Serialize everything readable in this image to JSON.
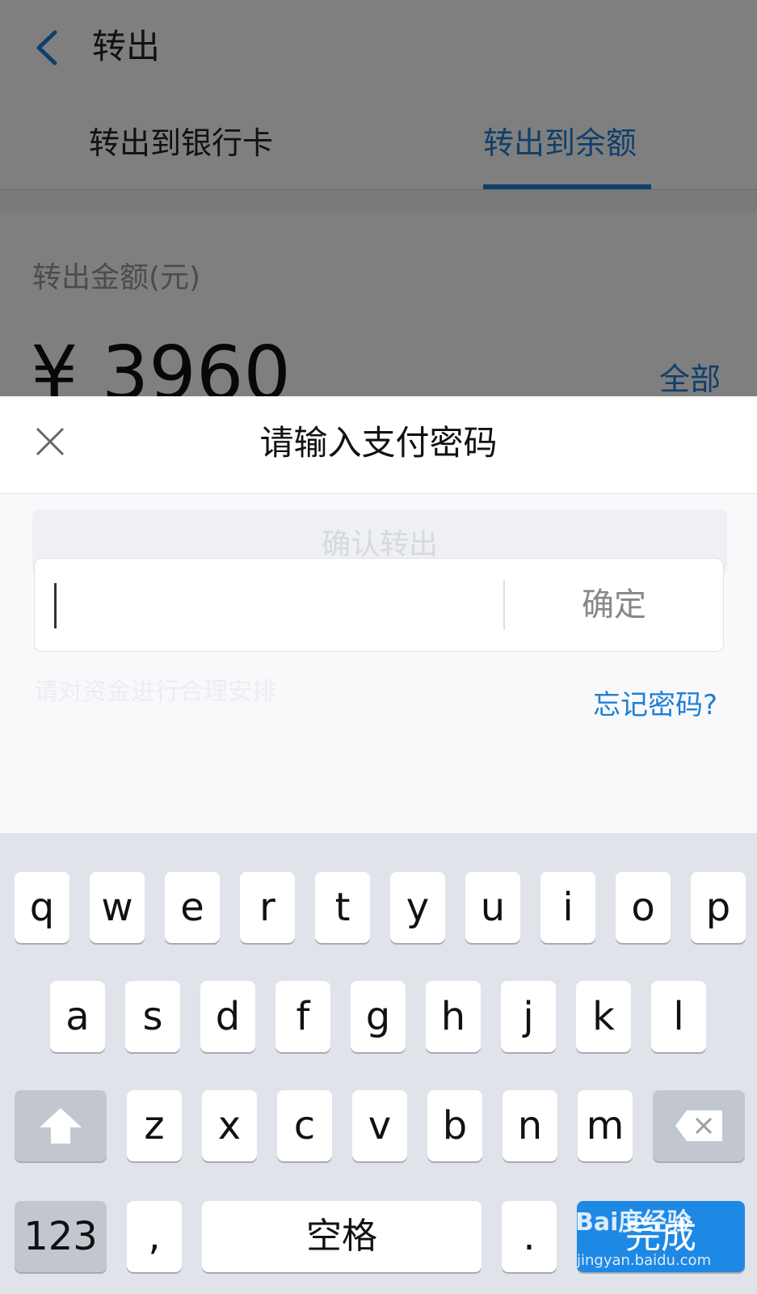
{
  "header": {
    "title": "转出"
  },
  "tabs": [
    {
      "label": "转出到银行卡",
      "active": false
    },
    {
      "label": "转出到余额",
      "active": true
    }
  ],
  "amount": {
    "label": "转出金额(元)",
    "value": "¥ 3960",
    "all_label": "全部"
  },
  "background_button": {
    "label": "确认转出"
  },
  "background_note": {
    "text": "请对资金进行合理安排"
  },
  "dialog": {
    "title": "请输入支付密码",
    "confirm_label": "确定",
    "forgot_label": "忘记密码?",
    "password_value": ""
  },
  "keyboard": {
    "row1": [
      "q",
      "w",
      "e",
      "r",
      "t",
      "y",
      "u",
      "i",
      "o",
      "p"
    ],
    "row2": [
      "a",
      "s",
      "d",
      "f",
      "g",
      "h",
      "j",
      "k",
      "l"
    ],
    "row3": [
      "z",
      "x",
      "c",
      "v",
      "b",
      "n",
      "m"
    ],
    "numbers_label": "123",
    "comma_label": ",",
    "space_label": "空格",
    "period_label": ".",
    "done_label": "完成"
  },
  "watermark": {
    "main": "Bai度经验",
    "sub": "jingyan.baidu.com"
  },
  "colors": {
    "accent": "#1e7fd6",
    "done_key": "#1e88e5",
    "keyboard_bg": "#e0e3ea",
    "overlay": "rgba(0,0,0,0.5)"
  },
  "icons": {
    "back": "chevron-left-icon",
    "close": "close-icon",
    "shift": "shift-arrow-icon",
    "delete": "backspace-icon"
  }
}
